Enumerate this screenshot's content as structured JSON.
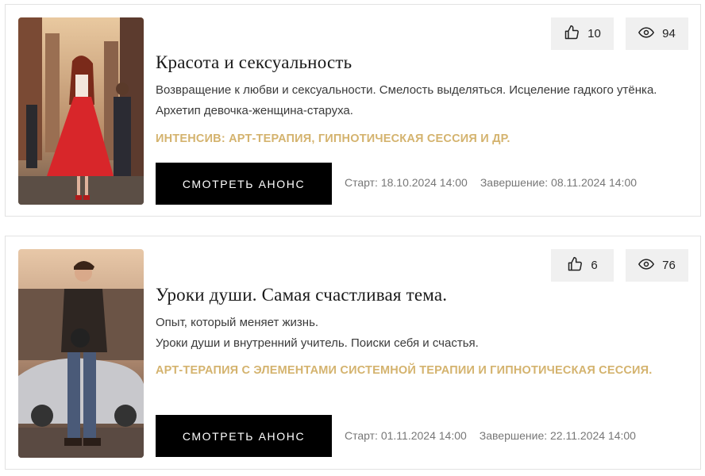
{
  "cards": [
    {
      "likes": "10",
      "views": "94",
      "title": "Красота и сексуальность",
      "description": [
        "Возвращение к любви и сексуальности. Смелость выделяться. Исцеление гадкого утёнка. Архетип девочка-женщина-старуха."
      ],
      "tag": "ИНТЕНСИВ: АРТ-ТЕРАПИЯ, ГИПНОТИЧЕСКАЯ СЕССИЯ И ДР.",
      "button_label": "СМОТРЕТЬ АНОНС",
      "start": "Старт: 18.10.2024 14:00",
      "end": "Завершение: 08.11.2024 14:00"
    },
    {
      "likes": "6",
      "views": "76",
      "title": "Уроки души. Самая счастливая тема.",
      "description": [
        "Опыт, который меняет жизнь.",
        "Уроки души и внутренний учитель. Поиски себя и счастья."
      ],
      "tag": "АРТ-ТЕРАПИЯ С ЭЛЕМЕНТАМИ СИСТЕМНОЙ ТЕРАПИИ И ГИПНОТИЧЕСКАЯ СЕССИЯ.",
      "button_label": "СМОТРЕТЬ АНОНС",
      "start": "Старт: 01.11.2024 14:00",
      "end": "Завершение: 22.11.2024 14:00"
    }
  ],
  "icons": {
    "likes": "thumbs-up-icon",
    "views": "eye-icon"
  },
  "colors": {
    "accent": "#d4b36e",
    "button_bg": "#000000",
    "stat_bg": "#f0f0f0"
  }
}
